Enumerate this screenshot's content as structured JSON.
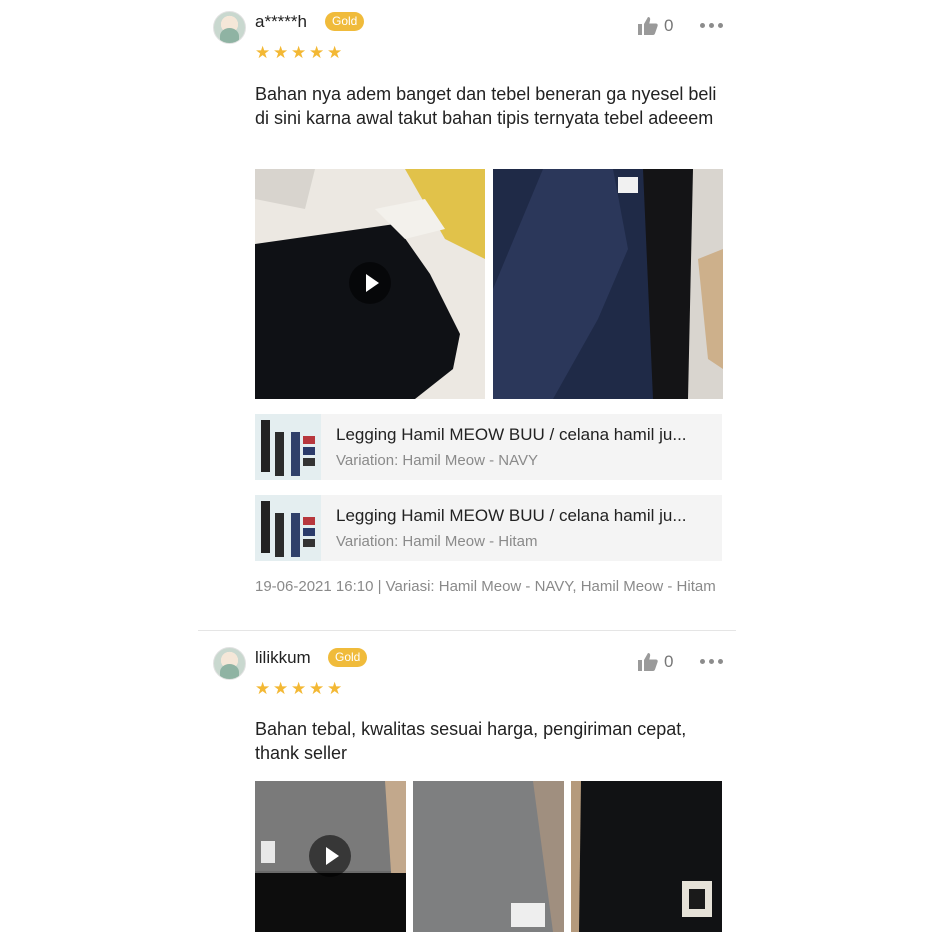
{
  "reviews": [
    {
      "username": "a*****h",
      "badge": "Gold",
      "likes": "0",
      "rating": 5,
      "text": "Bahan nya adem banget dan tebel beneran ga nyesel beli di sini karna awal takut bahan tipis ternyata tebel adeeem",
      "products": [
        {
          "name": "Legging Hamil MEOW BUU / celana hamil ju...",
          "variation": "Variation: Hamil Meow - NAVY"
        },
        {
          "name": "Legging Hamil MEOW BUU / celana hamil ju...",
          "variation": "Variation: Hamil Meow - Hitam"
        }
      ],
      "meta": "19-06-2021 16:10 | Variasi: Hamil Meow - NAVY, Hamil Meow - Hitam"
    },
    {
      "username": "lilikkum",
      "badge": "Gold",
      "likes": "0",
      "rating": 5,
      "text": "Bahan tebal, kwalitas sesuai harga, pengiriman cepat, thank seller"
    }
  ],
  "colors": {
    "accent_gold": "#f0bb3b",
    "star": "#f3b834",
    "muted": "#8a8a8a"
  },
  "icons": {
    "like": "thumbs-up-icon",
    "more": "more-dots-icon",
    "play": "play-icon",
    "star": "star-icon"
  }
}
